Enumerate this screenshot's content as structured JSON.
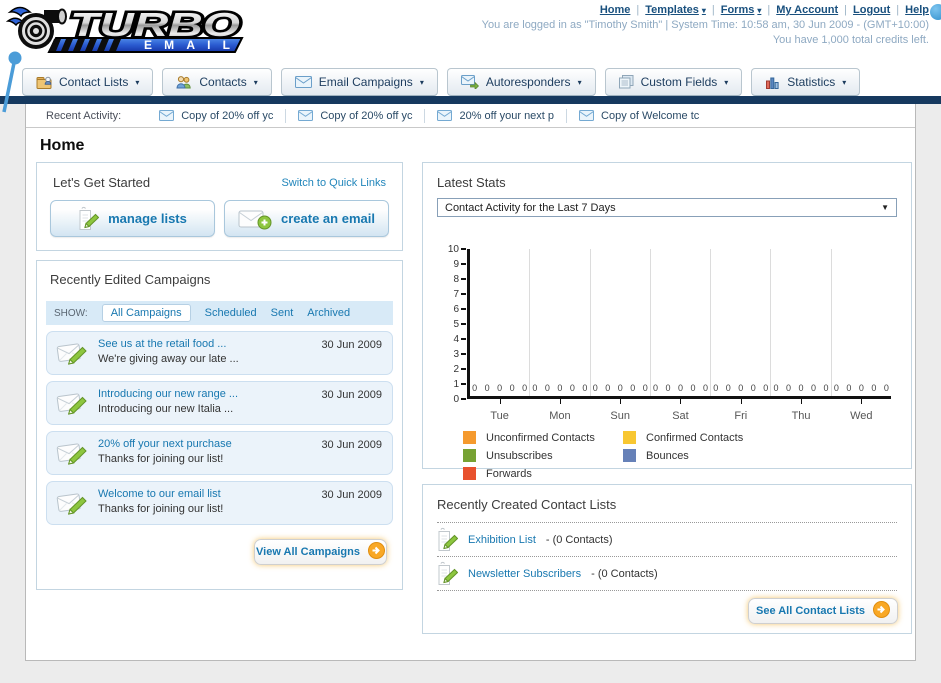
{
  "header": {
    "logo": {
      "title": "TURBO",
      "subtitle": "EMAIL"
    },
    "nav_links": [
      {
        "label": "Home",
        "dropdown": false
      },
      {
        "label": "Templates",
        "dropdown": true
      },
      {
        "label": "Forms",
        "dropdown": true
      },
      {
        "label": "My Account",
        "dropdown": false
      },
      {
        "label": "Logout",
        "dropdown": false
      },
      {
        "label": "Help",
        "dropdown": false
      }
    ],
    "login_status": "You are logged in as \"Timothy Smith\" | System Time: 10:58 am, 30 Jun 2009 - (GMT+10:00)",
    "credits": "You have 1,000 total credits left."
  },
  "nav_tabs": [
    {
      "label": "Contact Lists",
      "icon": "contact-lists-icon"
    },
    {
      "label": "Contacts",
      "icon": "contacts-icon"
    },
    {
      "label": "Email Campaigns",
      "icon": "email-campaigns-icon"
    },
    {
      "label": "Autoresponders",
      "icon": "autoresponders-icon"
    },
    {
      "label": "Custom Fields",
      "icon": "custom-fields-icon"
    },
    {
      "label": "Statistics",
      "icon": "statistics-icon"
    }
  ],
  "recent_activity": {
    "label": "Recent Activity:",
    "items": [
      "Copy of 20% off yc",
      "Copy of 20% off yc",
      "20% off your next p",
      "Copy of Welcome tc"
    ]
  },
  "page_title": "Home",
  "get_started": {
    "title": "Let's Get Started",
    "switch_link": "Switch to Quick Links",
    "buttons": [
      {
        "label": "manage lists",
        "icon": "notepad-pencil-icon"
      },
      {
        "label": "create an email",
        "icon": "envelope-plus-icon"
      }
    ]
  },
  "campaigns": {
    "title": "Recently Edited Campaigns",
    "show_label": "SHOW:",
    "filters": [
      "All Campaigns",
      "Scheduled",
      "Sent",
      "Archived"
    ],
    "active_filter": "All Campaigns",
    "items": [
      {
        "title": "See us at the retail food ...",
        "subtitle": "We're giving away our late ...",
        "date": "30 Jun 2009"
      },
      {
        "title": "Introducing our new range ...",
        "subtitle": "Introducing our new Italia ...",
        "date": "30 Jun 2009"
      },
      {
        "title": "20% off your next purchase",
        "subtitle": "Thanks for joining our list!",
        "date": "30 Jun 2009"
      },
      {
        "title": "Welcome to our email list",
        "subtitle": "Thanks for joining our list!",
        "date": "30 Jun 2009"
      }
    ],
    "view_all_label": "View All Campaigns"
  },
  "latest_stats": {
    "title": "Latest Stats",
    "dropdown_value": "Contact Activity for the Last 7 Days"
  },
  "chart_data": {
    "type": "bar",
    "title": "Contact Activity for the Last 7 Days",
    "categories": [
      "Tue",
      "Mon",
      "Sun",
      "Sat",
      "Fri",
      "Thu",
      "Wed"
    ],
    "series": [
      {
        "name": "Unconfirmed Contacts",
        "color": "#f59a2e",
        "values": [
          0,
          0,
          0,
          0,
          0,
          0,
          0
        ]
      },
      {
        "name": "Confirmed Contacts",
        "color": "#f8c732",
        "values": [
          0,
          0,
          0,
          0,
          0,
          0,
          0
        ]
      },
      {
        "name": "Unsubscribes",
        "color": "#77a233",
        "values": [
          0,
          0,
          0,
          0,
          0,
          0,
          0
        ]
      },
      {
        "name": "Bounces",
        "color": "#6681b8",
        "values": [
          0,
          0,
          0,
          0,
          0,
          0,
          0
        ]
      },
      {
        "name": "Forwards",
        "color": "#e8512e",
        "values": [
          0,
          0,
          0,
          0,
          0,
          0,
          0
        ]
      }
    ],
    "ylim": [
      0,
      10
    ],
    "yticks": [
      0,
      1,
      2,
      3,
      4,
      5,
      6,
      7,
      8,
      9,
      10
    ],
    "grid": true,
    "legend_position": "bottom"
  },
  "contact_lists": {
    "title": "Recently Created Contact Lists",
    "items": [
      {
        "name": "Exhibition List",
        "detail": "- (0 Contacts)"
      },
      {
        "name": "Newsletter Subscribers",
        "detail": "- (0 Contacts)"
      }
    ],
    "see_all_label": "See All Contact Lists"
  },
  "colors": {
    "navy_bar": "#16395f",
    "link_blue": "#1878b0",
    "header_link": "#19507e",
    "status_text": "#8ea9c2",
    "panel_border": "#c3d5e1",
    "row_bg": "#ebf3fa",
    "show_bar_bg": "#d8eaf7",
    "button_glow": "#f3ba4c",
    "logo_blue": "#2a5bd0",
    "pin_blue": "#4b9cd8"
  }
}
